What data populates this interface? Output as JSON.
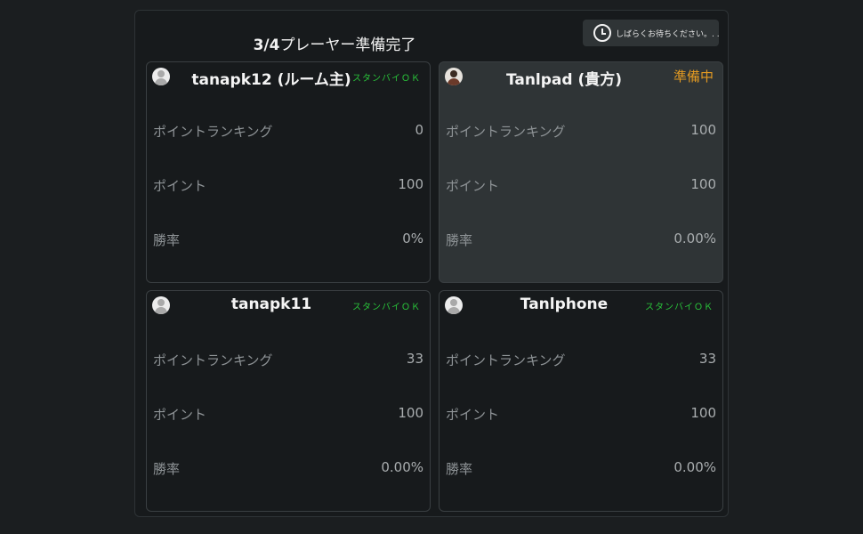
{
  "lobby": {
    "ready_count": "3/4",
    "title_suffix": "プレーヤー準備完了",
    "wait_text": "しばらくお待ちください。. .",
    "wait_icon": "clock-icon"
  },
  "labels": {
    "ranking": "ポイントランキング",
    "points": "ポイント",
    "win_rate": "勝率"
  },
  "players": [
    {
      "name": "tanapk12 (ルーム主)",
      "status": "スタンバイＯＫ",
      "status_color": "#29c23a",
      "ranking": "0",
      "points": "100",
      "win_rate": "0%"
    },
    {
      "name": "Tanlpad (貴方)",
      "status": "準備中",
      "status_color": "#e39a22",
      "ranking": "100",
      "points": "100",
      "win_rate": "0.00%"
    },
    {
      "name": "tanapk11",
      "status": "スタンバイＯＫ",
      "status_color": "#29c23a",
      "ranking": "33",
      "points": "100",
      "win_rate": "0.00%"
    },
    {
      "name": "Tanlphone",
      "status": "スタンバイＯＫ",
      "status_color": "#29c23a",
      "ranking": "33",
      "points": "100",
      "win_rate": "0.00%"
    }
  ]
}
